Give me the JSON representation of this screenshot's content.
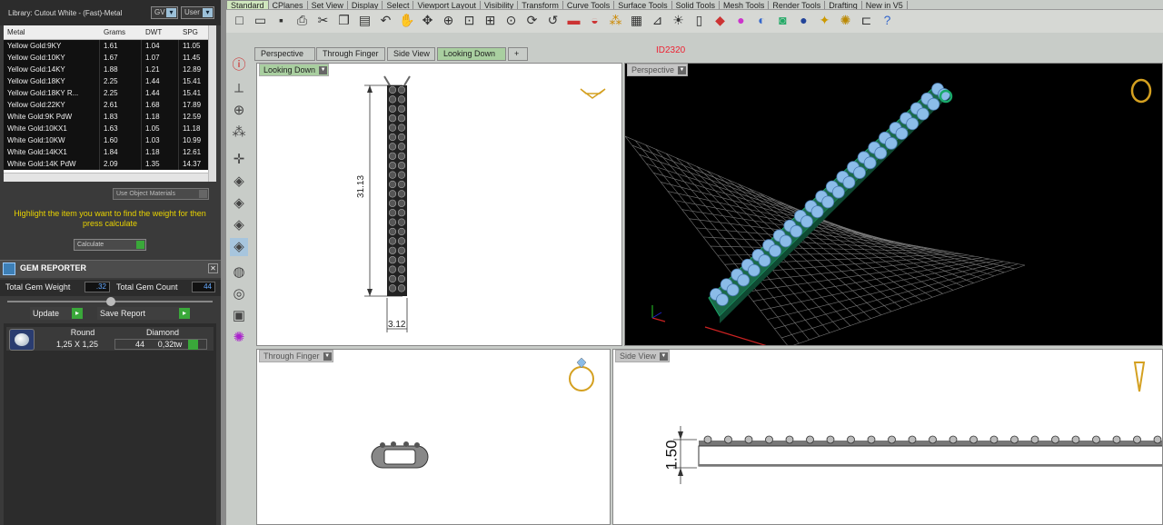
{
  "library": {
    "title": "Library: Cutout White - (Fast)-Metal",
    "btn_gv": "GV",
    "btn_user": "User",
    "columns": [
      "Metal",
      "Grams",
      "DWT",
      "SPG"
    ],
    "rows": [
      [
        "Yellow Gold:9KY",
        "1.61",
        "1.04",
        "11.05"
      ],
      [
        "Yellow Gold:10KY",
        "1.67",
        "1.07",
        "11.45"
      ],
      [
        "Yellow Gold:14KY",
        "1.88",
        "1.21",
        "12.89"
      ],
      [
        "Yellow Gold:18KY",
        "2.25",
        "1.44",
        "15.41"
      ],
      [
        "Yellow Gold:18KY R...",
        "2.25",
        "1.44",
        "15.41"
      ],
      [
        "Yellow Gold:22KY",
        "2.61",
        "1.68",
        "17.89"
      ],
      [
        "White Gold:9K PdW",
        "1.83",
        "1.18",
        "12.59"
      ],
      [
        "White Gold:10KX1",
        "1.63",
        "1.05",
        "11.18"
      ],
      [
        "White Gold:10KW",
        "1.60",
        "1.03",
        "10.99"
      ],
      [
        "White Gold:14KX1",
        "1.84",
        "1.18",
        "12.61"
      ],
      [
        "White Gold:14K PdW",
        "2.09",
        "1.35",
        "14.37"
      ]
    ],
    "use_object_materials": "Use Object Materials",
    "hint": "Highlight the item you want to find the weight for then press calculate",
    "calculate": "Calculate"
  },
  "gem_reporter": {
    "title": "GEM REPORTER",
    "total_weight_label": "Total Gem Weight",
    "total_weight_value": ".32",
    "total_count_label": "Total Gem Count",
    "total_count_value": "44",
    "update": "Update",
    "save_report": "Save Report",
    "gem": {
      "shape": "Round",
      "type": "Diamond",
      "size": "1,25 X 1,25",
      "count": "44",
      "weight": "0,32tw"
    }
  },
  "menu_tabs": [
    "Standard",
    "CPlanes",
    "Set View",
    "Display",
    "Select",
    "Viewport Layout",
    "Visibility",
    "Transform",
    "Curve Tools",
    "Surface Tools",
    "Solid Tools",
    "Mesh Tools",
    "Render Tools",
    "Drafting",
    "New in V5"
  ],
  "view_tabs": [
    "Perspective",
    "Through Finger",
    "Side View",
    "Looking Down",
    "+"
  ],
  "doc_id": "ID2320",
  "viewports": {
    "looking_down": {
      "label": "Looking Down",
      "dim_length": "31.13",
      "dim_width": "3.12"
    },
    "perspective": {
      "label": "Perspective"
    },
    "through_finger": {
      "label": "Through Finger"
    },
    "side_view": {
      "label": "Side View",
      "dim_height": "1.50"
    }
  },
  "colors": {
    "gem_blue": "#8bbce8",
    "metal_green": "#1aa86a",
    "dark_panel": "#3a3a3a",
    "accent_yellow": "#e8d200"
  }
}
